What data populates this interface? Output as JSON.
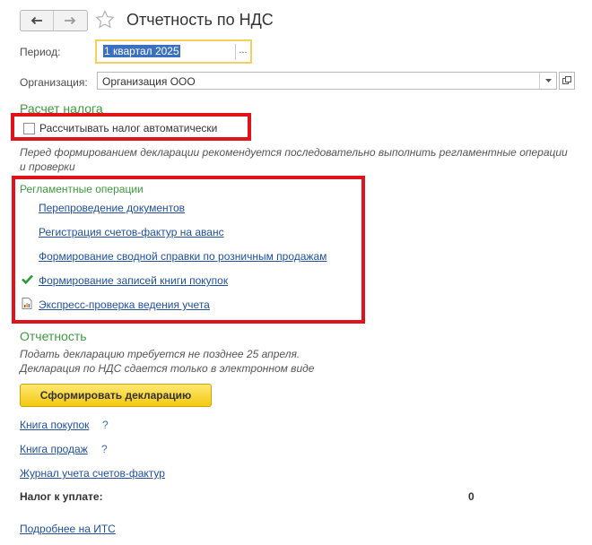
{
  "window": {
    "title": "Отчетность по НДС"
  },
  "toolbar": {
    "back_icon": "arrow-left-icon",
    "forward_icon": "arrow-right-icon",
    "favorite_icon": "star-icon"
  },
  "period": {
    "label": "Период:",
    "value": "1 квартал 2025",
    "button": "..."
  },
  "organization": {
    "label": "Организация:",
    "value": "Организация ООО"
  },
  "tax_calc": {
    "heading": "Расчет налога",
    "auto_checkbox_label": "Рассчитывать налог автоматически",
    "auto_checked": false
  },
  "notice": "Перед формированием декларации рекомендуется последовательно выполнить регламентные операции и проверки",
  "operations": {
    "heading": "Регламентные операции",
    "items": [
      {
        "label": "Перепроведение документов",
        "status": "none"
      },
      {
        "label": "Регистрация счетов-фактур на аванс",
        "status": "none"
      },
      {
        "label": "Формирование сводной справки по розничным продажам",
        "status": "none"
      },
      {
        "label": "Формирование записей книги покупок",
        "status": "done",
        "icon": "checkmark-icon"
      },
      {
        "label": "Экспресс-проверка ведения учета",
        "status": "report",
        "icon": "report-icon"
      }
    ]
  },
  "reporting": {
    "heading": "Отчетность",
    "deadline_text": "Подать декларацию требуется не позднее 25 апреля.",
    "format_text": "Декларация по НДС сдается только в электронном виде",
    "generate_button": "Сформировать декларацию",
    "links": [
      {
        "label": "Книга покупок",
        "help": "?"
      },
      {
        "label": "Книга продаж",
        "help": "?"
      },
      {
        "label": "Журнал учета счетов-фактур",
        "help": ""
      }
    ],
    "tax_label": "Налог к уплате:",
    "tax_value": "0",
    "more_link": "Подробнее на ИТС"
  },
  "colors": {
    "accent_green": "#3d9a3d",
    "highlight_red": "#e0121b",
    "link_blue": "#1f4f9e",
    "button_yellow": "#f3c90f"
  }
}
